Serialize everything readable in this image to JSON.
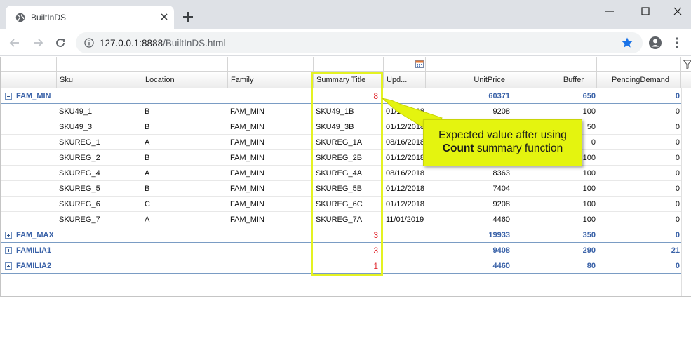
{
  "browser": {
    "tab_title": "BuiltInDS",
    "url_host": "127.0.0.1:8888",
    "url_path": "/BuiltInDS.html"
  },
  "grid": {
    "columns": [
      {
        "key": "sku",
        "label": "Sku"
      },
      {
        "key": "location",
        "label": "Location"
      },
      {
        "key": "family",
        "label": "Family"
      },
      {
        "key": "summary",
        "label": "Summary Title"
      },
      {
        "key": "upd",
        "label": "Upd..."
      },
      {
        "key": "unitprice",
        "label": "UnitPrice"
      },
      {
        "key": "buffer",
        "label": "Buffer"
      },
      {
        "key": "pending",
        "label": "PendingDemand"
      }
    ],
    "groups": [
      {
        "label": "FAM_MIN",
        "count": "8",
        "unitprice": "60371",
        "buffer": "650",
        "pending": "0",
        "rows": [
          {
            "sku": "SKU49_1",
            "location": "B",
            "family": "FAM_MIN",
            "summary": "SKU49_1B",
            "upd": "01/12/2018",
            "unitprice": "9208",
            "buffer": "100",
            "pending": "0"
          },
          {
            "sku": "SKU49_3",
            "location": "B",
            "family": "FAM_MIN",
            "summary": "SKU49_3B",
            "upd": "01/12/2018",
            "unitprice": "",
            "buffer": "50",
            "pending": "0"
          },
          {
            "sku": "SKUREG_1",
            "location": "A",
            "family": "FAM_MIN",
            "summary": "SKUREG_1A",
            "upd": "08/16/2018",
            "unitprice": "",
            "buffer": "0",
            "pending": "0"
          },
          {
            "sku": "SKUREG_2",
            "location": "B",
            "family": "FAM_MIN",
            "summary": "SKUREG_2B",
            "upd": "01/12/2018",
            "unitprice": "",
            "buffer": "100",
            "pending": "0"
          },
          {
            "sku": "SKUREG_4",
            "location": "A",
            "family": "FAM_MIN",
            "summary": "SKUREG_4A",
            "upd": "08/16/2018",
            "unitprice": "8363",
            "buffer": "100",
            "pending": "0"
          },
          {
            "sku": "SKUREG_5",
            "location": "B",
            "family": "FAM_MIN",
            "summary": "SKUREG_5B",
            "upd": "01/12/2018",
            "unitprice": "7404",
            "buffer": "100",
            "pending": "0"
          },
          {
            "sku": "SKUREG_6",
            "location": "C",
            "family": "FAM_MIN",
            "summary": "SKUREG_6C",
            "upd": "01/12/2018",
            "unitprice": "9208",
            "buffer": "100",
            "pending": "0"
          },
          {
            "sku": "SKUREG_7",
            "location": "A",
            "family": "FAM_MIN",
            "summary": "SKUREG_7A",
            "upd": "11/01/2019",
            "unitprice": "4460",
            "buffer": "100",
            "pending": "0"
          }
        ]
      },
      {
        "label": "FAM_MAX",
        "count": "3",
        "unitprice": "19933",
        "buffer": "350",
        "pending": "0",
        "rows": []
      },
      {
        "label": "FAMILIA1",
        "count": "3",
        "unitprice": "9408",
        "buffer": "290",
        "pending": "21",
        "rows": []
      },
      {
        "label": "FAMILIA2",
        "count": "1",
        "unitprice": "4460",
        "buffer": "80",
        "pending": "0",
        "rows": []
      }
    ]
  },
  "callout": {
    "line1": "Expected value after using",
    "bold": "Count",
    "line2_rest": " summary function"
  },
  "colors": {
    "highlight": "#e4f222",
    "count_red": "#e0282e",
    "group_blue": "#3a62a8"
  }
}
